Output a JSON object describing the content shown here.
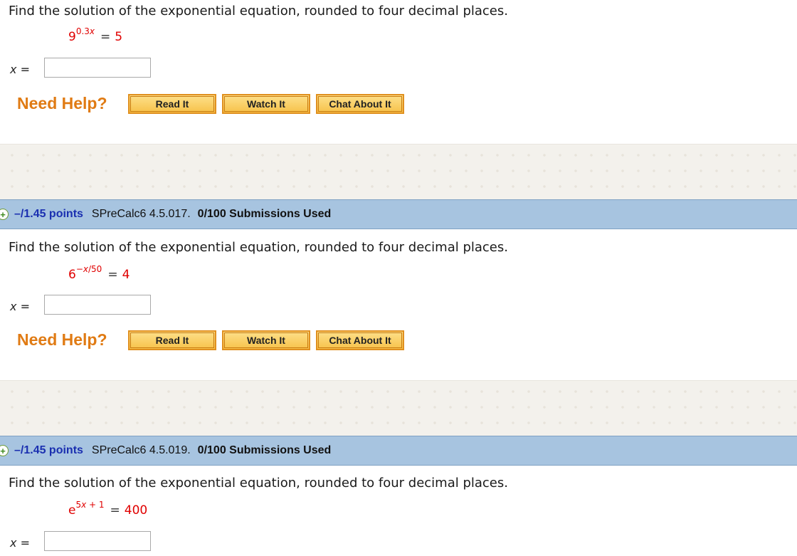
{
  "questions": [
    {
      "prompt": "Find the solution of the exponential equation, rounded to four decimal places.",
      "equation": {
        "base": "9",
        "exponent_num": "0.3",
        "exponent_var": "x",
        "exponent_rest": "",
        "rhs": "5"
      },
      "answer_label_var": "x",
      "answer_label_eq": "=",
      "answer_value": ""
    },
    {
      "header": {
        "points": "–/1.45 points",
        "id": "SPreCalc6 4.5.017.",
        "submissions": "0/100 Submissions Used"
      },
      "prompt": "Find the solution of the exponential equation, rounded to four decimal places.",
      "equation": {
        "base": "6",
        "exponent_num": "−",
        "exponent_var": "x",
        "exponent_rest": "/50",
        "rhs": "4"
      },
      "answer_label_var": "x",
      "answer_label_eq": "=",
      "answer_value": ""
    },
    {
      "header": {
        "points": "–/1.45 points",
        "id": "SPreCalc6 4.5.019.",
        "submissions": "0/100 Submissions Used"
      },
      "prompt": "Find the solution of the exponential equation, rounded to four decimal places.",
      "equation": {
        "base": "e",
        "exponent_num": "5",
        "exponent_var": "x",
        "exponent_rest": " + 1",
        "rhs": "400"
      },
      "answer_label_var": "x",
      "answer_label_eq": "=",
      "answer_value": ""
    }
  ],
  "help": {
    "label": "Need Help?",
    "read": "Read It",
    "watch": "Watch It",
    "chat": "Chat About It"
  },
  "colors": {
    "header_bg": "#a7c4e0",
    "points": "#1a2fb0",
    "need_help": "#e07b14",
    "equation": "#e00000"
  }
}
